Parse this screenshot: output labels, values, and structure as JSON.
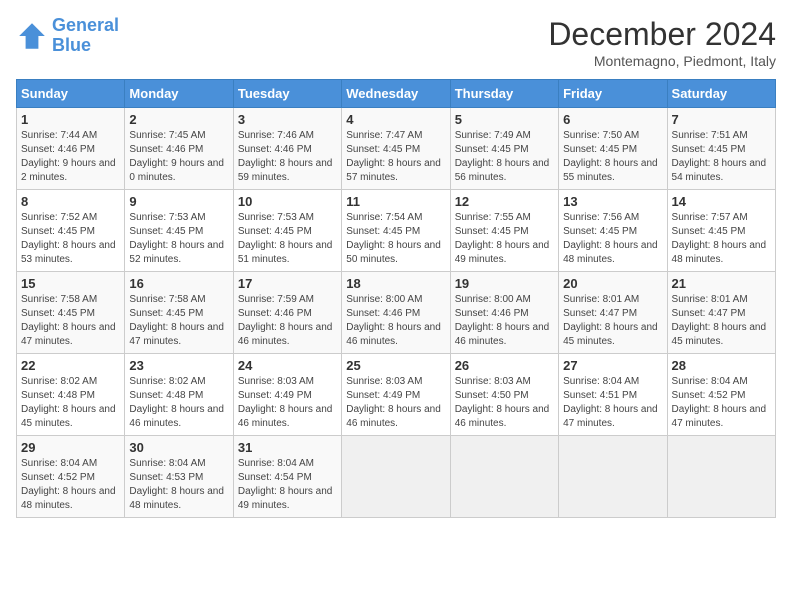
{
  "logo": {
    "line1": "General",
    "line2": "Blue"
  },
  "title": "December 2024",
  "subtitle": "Montemagno, Piedmont, Italy",
  "days_of_week": [
    "Sunday",
    "Monday",
    "Tuesday",
    "Wednesday",
    "Thursday",
    "Friday",
    "Saturday"
  ],
  "weeks": [
    [
      {
        "day": "1",
        "sunrise": "7:44 AM",
        "sunset": "4:46 PM",
        "daylight": "9 hours and 2 minutes."
      },
      {
        "day": "2",
        "sunrise": "7:45 AM",
        "sunset": "4:46 PM",
        "daylight": "9 hours and 0 minutes."
      },
      {
        "day": "3",
        "sunrise": "7:46 AM",
        "sunset": "4:46 PM",
        "daylight": "8 hours and 59 minutes."
      },
      {
        "day": "4",
        "sunrise": "7:47 AM",
        "sunset": "4:45 PM",
        "daylight": "8 hours and 57 minutes."
      },
      {
        "day": "5",
        "sunrise": "7:49 AM",
        "sunset": "4:45 PM",
        "daylight": "8 hours and 56 minutes."
      },
      {
        "day": "6",
        "sunrise": "7:50 AM",
        "sunset": "4:45 PM",
        "daylight": "8 hours and 55 minutes."
      },
      {
        "day": "7",
        "sunrise": "7:51 AM",
        "sunset": "4:45 PM",
        "daylight": "8 hours and 54 minutes."
      }
    ],
    [
      {
        "day": "8",
        "sunrise": "7:52 AM",
        "sunset": "4:45 PM",
        "daylight": "8 hours and 53 minutes."
      },
      {
        "day": "9",
        "sunrise": "7:53 AM",
        "sunset": "4:45 PM",
        "daylight": "8 hours and 52 minutes."
      },
      {
        "day": "10",
        "sunrise": "7:53 AM",
        "sunset": "4:45 PM",
        "daylight": "8 hours and 51 minutes."
      },
      {
        "day": "11",
        "sunrise": "7:54 AM",
        "sunset": "4:45 PM",
        "daylight": "8 hours and 50 minutes."
      },
      {
        "day": "12",
        "sunrise": "7:55 AM",
        "sunset": "4:45 PM",
        "daylight": "8 hours and 49 minutes."
      },
      {
        "day": "13",
        "sunrise": "7:56 AM",
        "sunset": "4:45 PM",
        "daylight": "8 hours and 48 minutes."
      },
      {
        "day": "14",
        "sunrise": "7:57 AM",
        "sunset": "4:45 PM",
        "daylight": "8 hours and 48 minutes."
      }
    ],
    [
      {
        "day": "15",
        "sunrise": "7:58 AM",
        "sunset": "4:45 PM",
        "daylight": "8 hours and 47 minutes."
      },
      {
        "day": "16",
        "sunrise": "7:58 AM",
        "sunset": "4:45 PM",
        "daylight": "8 hours and 47 minutes."
      },
      {
        "day": "17",
        "sunrise": "7:59 AM",
        "sunset": "4:46 PM",
        "daylight": "8 hours and 46 minutes."
      },
      {
        "day": "18",
        "sunrise": "8:00 AM",
        "sunset": "4:46 PM",
        "daylight": "8 hours and 46 minutes."
      },
      {
        "day": "19",
        "sunrise": "8:00 AM",
        "sunset": "4:46 PM",
        "daylight": "8 hours and 46 minutes."
      },
      {
        "day": "20",
        "sunrise": "8:01 AM",
        "sunset": "4:47 PM",
        "daylight": "8 hours and 45 minutes."
      },
      {
        "day": "21",
        "sunrise": "8:01 AM",
        "sunset": "4:47 PM",
        "daylight": "8 hours and 45 minutes."
      }
    ],
    [
      {
        "day": "22",
        "sunrise": "8:02 AM",
        "sunset": "4:48 PM",
        "daylight": "8 hours and 45 minutes."
      },
      {
        "day": "23",
        "sunrise": "8:02 AM",
        "sunset": "4:48 PM",
        "daylight": "8 hours and 46 minutes."
      },
      {
        "day": "24",
        "sunrise": "8:03 AM",
        "sunset": "4:49 PM",
        "daylight": "8 hours and 46 minutes."
      },
      {
        "day": "25",
        "sunrise": "8:03 AM",
        "sunset": "4:49 PM",
        "daylight": "8 hours and 46 minutes."
      },
      {
        "day": "26",
        "sunrise": "8:03 AM",
        "sunset": "4:50 PM",
        "daylight": "8 hours and 46 minutes."
      },
      {
        "day": "27",
        "sunrise": "8:04 AM",
        "sunset": "4:51 PM",
        "daylight": "8 hours and 47 minutes."
      },
      {
        "day": "28",
        "sunrise": "8:04 AM",
        "sunset": "4:52 PM",
        "daylight": "8 hours and 47 minutes."
      }
    ],
    [
      {
        "day": "29",
        "sunrise": "8:04 AM",
        "sunset": "4:52 PM",
        "daylight": "8 hours and 48 minutes."
      },
      {
        "day": "30",
        "sunrise": "8:04 AM",
        "sunset": "4:53 PM",
        "daylight": "8 hours and 48 minutes."
      },
      {
        "day": "31",
        "sunrise": "8:04 AM",
        "sunset": "4:54 PM",
        "daylight": "8 hours and 49 minutes."
      },
      null,
      null,
      null,
      null
    ]
  ]
}
